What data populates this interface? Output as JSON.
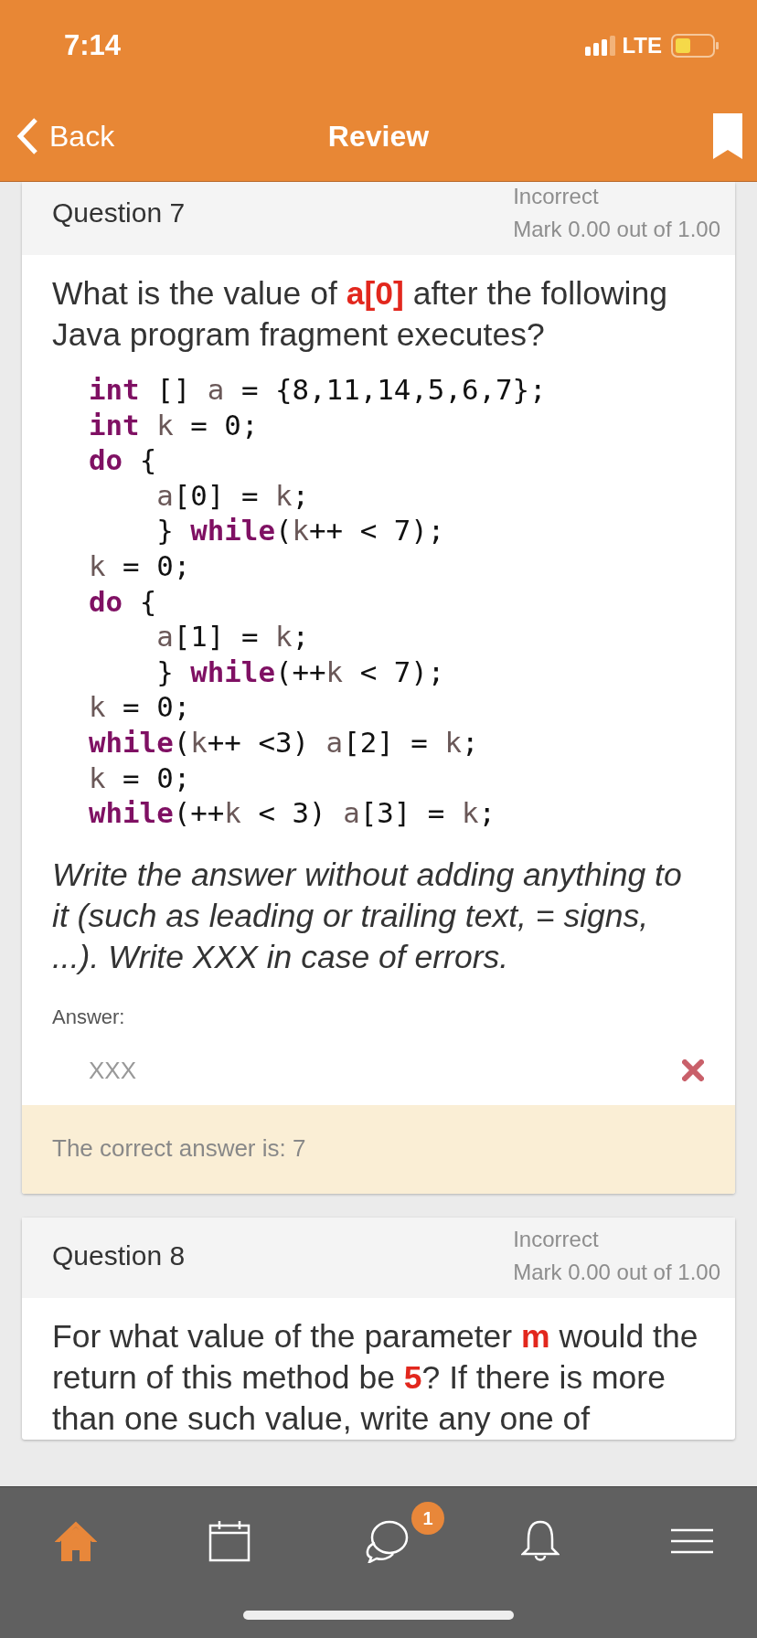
{
  "status_bar": {
    "time": "7:14",
    "network": "LTE"
  },
  "nav_bar": {
    "back": "Back",
    "title": "Review"
  },
  "questions": [
    {
      "title": "Question 7",
      "state": "Incorrect",
      "mark": "Mark 0.00 out of 1.00",
      "text": "What is the value of **a[0]** after the following Java program fragment executes?",
      "code": [
        [
          {
            "kind": "keyword",
            "text": "int"
          },
          {
            "kind": "plain",
            "text": " [] "
          },
          {
            "kind": "ident",
            "text": "a"
          },
          {
            "kind": "plain",
            "text": " = {8,11,14,5,6,7};"
          }
        ],
        [
          {
            "kind": "keyword",
            "text": "int"
          },
          {
            "kind": "ident",
            "text": " k"
          },
          {
            "kind": "plain",
            "text": " = 0;"
          }
        ],
        [
          {
            "kind": "keyword",
            "text": "do"
          },
          {
            "kind": "plain",
            "text": " {"
          }
        ],
        [
          {
            "kind": "ident",
            "text": "    a"
          },
          {
            "kind": "plain",
            "text": "[0] = "
          },
          {
            "kind": "ident",
            "text": "k"
          },
          {
            "kind": "plain",
            "text": ";"
          }
        ],
        [
          {
            "kind": "plain",
            "text": "    } "
          },
          {
            "kind": "keyword",
            "text": "while"
          },
          {
            "kind": "plain",
            "text": "("
          },
          {
            "kind": "ident",
            "text": "k"
          },
          {
            "kind": "plain",
            "text": "++ < 7);"
          }
        ],
        [
          {
            "kind": "ident",
            "text": "k"
          },
          {
            "kind": "plain",
            "text": " = 0;"
          }
        ],
        [
          {
            "kind": "keyword",
            "text": "do"
          },
          {
            "kind": "plain",
            "text": " {"
          }
        ],
        [
          {
            "kind": "ident",
            "text": "    a"
          },
          {
            "kind": "plain",
            "text": "[1] = "
          },
          {
            "kind": "ident",
            "text": "k"
          },
          {
            "kind": "plain",
            "text": ";"
          }
        ],
        [
          {
            "kind": "plain",
            "text": "    } "
          },
          {
            "kind": "keyword",
            "text": "while"
          },
          {
            "kind": "plain",
            "text": "(++"
          },
          {
            "kind": "ident",
            "text": "k"
          },
          {
            "kind": "plain",
            "text": " < 7);"
          }
        ],
        [
          {
            "kind": "ident",
            "text": "k"
          },
          {
            "kind": "plain",
            "text": " = 0;"
          }
        ],
        [
          {
            "kind": "keyword",
            "text": "while"
          },
          {
            "kind": "plain",
            "text": "("
          },
          {
            "kind": "ident",
            "text": "k"
          },
          {
            "kind": "plain",
            "text": "++ <3) "
          },
          {
            "kind": "ident",
            "text": "a"
          },
          {
            "kind": "plain",
            "text": "[2] = "
          },
          {
            "kind": "ident",
            "text": "k"
          },
          {
            "kind": "plain",
            "text": ";"
          }
        ],
        [
          {
            "kind": "ident",
            "text": "k"
          },
          {
            "kind": "plain",
            "text": " = 0;"
          }
        ],
        [
          {
            "kind": "keyword",
            "text": "while"
          },
          {
            "kind": "plain",
            "text": "(++"
          },
          {
            "kind": "ident",
            "text": "k"
          },
          {
            "kind": "plain",
            "text": " < 3) "
          },
          {
            "kind": "ident",
            "text": "a"
          },
          {
            "kind": "plain",
            "text": "[3] = "
          },
          {
            "kind": "ident",
            "text": "k"
          },
          {
            "kind": "plain",
            "text": ";"
          }
        ]
      ],
      "instruction": "Write the answer without adding anything to it (such as leading or trailing text, = signs, ...). Write XXX in case of errors.",
      "answer_label": "Answer:",
      "answer": "XXX",
      "correct": false,
      "feedback": "The correct answer is: 7"
    },
    {
      "title": "Question 8",
      "state": "Incorrect",
      "mark": "Mark 0.00 out of 1.00",
      "text": "For what value of the parameter **m** would the return of this method be **5**? If there is more than one such value, write any one of"
    }
  ],
  "tab_bar": [
    {
      "kind": "home",
      "selected": true
    },
    {
      "kind": "calendar",
      "selected": false
    },
    {
      "kind": "chat",
      "selected": false,
      "badge": "1"
    },
    {
      "kind": "bell",
      "selected": false
    },
    {
      "kind": "menu",
      "selected": false
    }
  ]
}
